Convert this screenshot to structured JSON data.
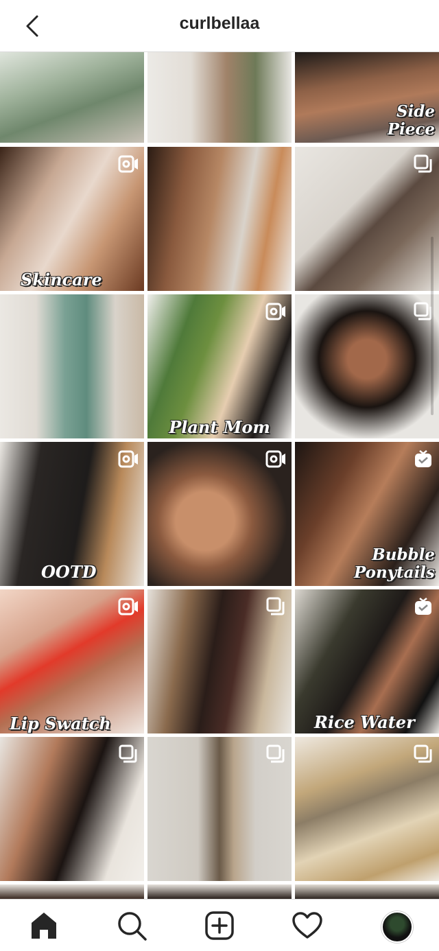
{
  "header": {
    "username": "curlbellaa"
  },
  "icons": {
    "back": "chevron-left-icon",
    "home": "home-icon",
    "search": "search-icon",
    "create": "add-post-icon",
    "activity": "heart-icon",
    "profile": "avatar"
  },
  "posts": [
    {
      "caption": "",
      "badge": "none"
    },
    {
      "caption": "",
      "badge": "none"
    },
    {
      "caption": "Side Piece",
      "badge": "none"
    },
    {
      "caption": "Skincare",
      "badge": "video"
    },
    {
      "caption": "",
      "badge": "none"
    },
    {
      "caption": "",
      "badge": "carousel"
    },
    {
      "caption": "",
      "badge": "none"
    },
    {
      "caption": "Plant Mom",
      "badge": "video"
    },
    {
      "caption": "",
      "badge": "carousel"
    },
    {
      "caption": "OOTD",
      "badge": "video"
    },
    {
      "caption": "",
      "badge": "video"
    },
    {
      "caption": "Bubble Ponytails",
      "badge": "igtv"
    },
    {
      "caption": "Lip Swatch",
      "badge": "video"
    },
    {
      "caption": "",
      "badge": "carousel"
    },
    {
      "caption": "Rice Water",
      "badge": "igtv"
    },
    {
      "caption": "",
      "badge": "carousel"
    },
    {
      "caption": "",
      "badge": "carousel"
    },
    {
      "caption": "",
      "badge": "carousel"
    }
  ],
  "colors": {
    "text": "#262626",
    "border": "#dbdbdb"
  }
}
